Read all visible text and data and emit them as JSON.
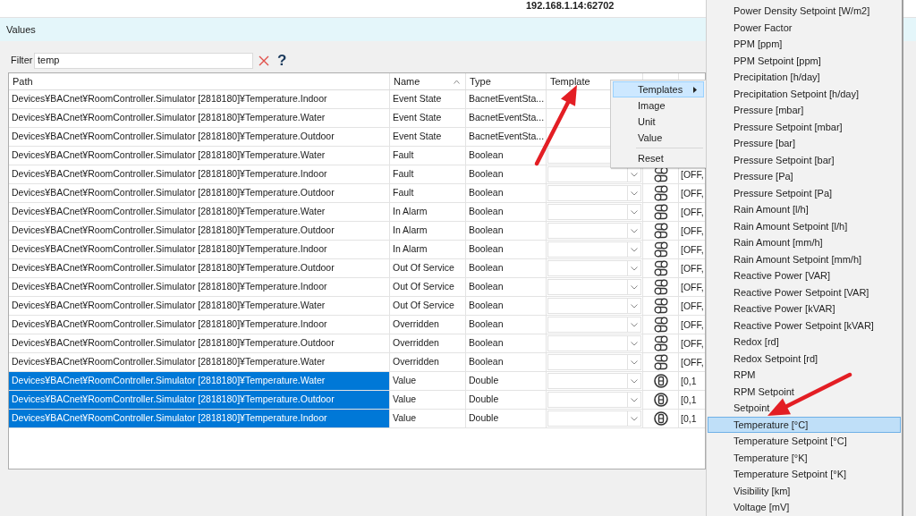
{
  "window": {
    "title": "192.168.1.14:62702"
  },
  "panel": {
    "title": "Values"
  },
  "filter": {
    "label": "Filter",
    "value": "temp",
    "help": "?"
  },
  "table": {
    "columns": [
      {
        "label": "Path",
        "sorted": false
      },
      {
        "label": "Name",
        "sorted": true
      },
      {
        "label": "Type",
        "sorted": false
      },
      {
        "label": "Template",
        "sorted": false
      }
    ],
    "rows": [
      {
        "path": "Devices¥BACnet¥RoomController.Simulator [2818180]¥Temperature.Indoor",
        "name": "Event State",
        "type": "BacnetEventSta...",
        "template_dropdown": false,
        "selected": false
      },
      {
        "path": "Devices¥BACnet¥RoomController.Simulator [2818180]¥Temperature.Water",
        "name": "Event State",
        "type": "BacnetEventSta...",
        "template_dropdown": false,
        "selected": false
      },
      {
        "path": "Devices¥BACnet¥RoomController.Simulator [2818180]¥Temperature.Outdoor",
        "name": "Event State",
        "type": "BacnetEventSta...",
        "template_dropdown": false,
        "selected": false
      },
      {
        "path": "Devices¥BACnet¥RoomController.Simulator [2818180]¥Temperature.Water",
        "name": "Fault",
        "type": "Boolean",
        "template_dropdown": true,
        "selected": false
      },
      {
        "path": "Devices¥BACnet¥RoomController.Simulator [2818180]¥Temperature.Indoor",
        "name": "Fault",
        "type": "Boolean",
        "template_dropdown": true,
        "column_5": {
          "kind": "switches"
        },
        "column_6": "[OFF,",
        "selected": false
      },
      {
        "path": "Devices¥BACnet¥RoomController.Simulator [2818180]¥Temperature.Outdoor",
        "name": "Fault",
        "type": "Boolean",
        "template_dropdown": true,
        "column_5": {
          "kind": "switches"
        },
        "column_6": "[OFF,",
        "selected": false
      },
      {
        "path": "Devices¥BACnet¥RoomController.Simulator [2818180]¥Temperature.Water",
        "name": "In Alarm",
        "type": "Boolean",
        "template_dropdown": true,
        "column_5": {
          "kind": "switches"
        },
        "column_6": "[OFF,",
        "selected": false
      },
      {
        "path": "Devices¥BACnet¥RoomController.Simulator [2818180]¥Temperature.Outdoor",
        "name": "In Alarm",
        "type": "Boolean",
        "template_dropdown": true,
        "column_5": {
          "kind": "switches"
        },
        "column_6": "[OFF,",
        "selected": false
      },
      {
        "path": "Devices¥BACnet¥RoomController.Simulator [2818180]¥Temperature.Indoor",
        "name": "In Alarm",
        "type": "Boolean",
        "template_dropdown": true,
        "column_5": {
          "kind": "switches"
        },
        "column_6": "[OFF,",
        "selected": false
      },
      {
        "path": "Devices¥BACnet¥RoomController.Simulator [2818180]¥Temperature.Outdoor",
        "name": "Out Of Service",
        "type": "Boolean",
        "template_dropdown": true,
        "column_5": {
          "kind": "switches"
        },
        "column_6": "[OFF,",
        "selected": false
      },
      {
        "path": "Devices¥BACnet¥RoomController.Simulator [2818180]¥Temperature.Indoor",
        "name": "Out Of Service",
        "type": "Boolean",
        "template_dropdown": true,
        "column_5": {
          "kind": "switches"
        },
        "column_6": "[OFF,",
        "selected": false
      },
      {
        "path": "Devices¥BACnet¥RoomController.Simulator [2818180]¥Temperature.Water",
        "name": "Out Of Service",
        "type": "Boolean",
        "template_dropdown": true,
        "column_5": {
          "kind": "switches"
        },
        "column_6": "[OFF,",
        "selected": false
      },
      {
        "path": "Devices¥BACnet¥RoomController.Simulator [2818180]¥Temperature.Indoor",
        "name": "Overridden",
        "type": "Boolean",
        "template_dropdown": true,
        "column_5": {
          "kind": "switches"
        },
        "column_6": "[OFF,",
        "selected": false
      },
      {
        "path": "Devices¥BACnet¥RoomController.Simulator [2818180]¥Temperature.Outdoor",
        "name": "Overridden",
        "type": "Boolean",
        "template_dropdown": true,
        "column_5": {
          "kind": "switches"
        },
        "column_6": "[OFF,",
        "selected": false
      },
      {
        "path": "Devices¥BACnet¥RoomController.Simulator [2818180]¥Temperature.Water",
        "name": "Overridden",
        "type": "Boolean",
        "template_dropdown": true,
        "column_5": {
          "kind": "switches"
        },
        "column_6": "[OFF,",
        "selected": false
      },
      {
        "path": "Devices¥BACnet¥RoomController.Simulator [2818180]¥Temperature.Water",
        "name": "Value",
        "type": "Double",
        "template_dropdown": true,
        "column_5": {
          "kind": "digit"
        },
        "column_6": "[0,1",
        "selected": true
      },
      {
        "path": "Devices¥BACnet¥RoomController.Simulator [2818180]¥Temperature.Outdoor",
        "name": "Value",
        "type": "Double",
        "template_dropdown": true,
        "column_5": {
          "kind": "digit"
        },
        "column_6": "[0,1",
        "selected": true
      },
      {
        "path": "Devices¥BACnet¥RoomController.Simulator [2818180]¥Temperature.Indoor",
        "name": "Value",
        "type": "Double",
        "template_dropdown": true,
        "column_5": {
          "kind": "digit"
        },
        "column_6": "[0,1",
        "selected": true
      }
    ]
  },
  "context_menu": {
    "items": [
      {
        "kind": "item",
        "label": "Templates",
        "selected": true,
        "submenu": true
      },
      {
        "kind": "item",
        "label": "Image",
        "selected": false,
        "submenu": false
      },
      {
        "kind": "item",
        "label": "Unit",
        "selected": false,
        "submenu": false
      },
      {
        "kind": "item",
        "label": "Value",
        "selected": false,
        "submenu": false
      },
      {
        "kind": "separator"
      },
      {
        "kind": "item",
        "label": "Reset",
        "selected": false,
        "submenu": false
      }
    ]
  },
  "submenu": {
    "items": [
      {
        "label": "Power Density Setpoint [W/m2]",
        "selected": false
      },
      {
        "label": "Power Factor",
        "selected": false
      },
      {
        "label": "PPM [ppm]",
        "selected": false
      },
      {
        "label": "PPM Setpoint [ppm]",
        "selected": false
      },
      {
        "label": "Precipitation [h/day]",
        "selected": false
      },
      {
        "label": "Precipitation Setpoint [h/day]",
        "selected": false
      },
      {
        "label": "Pressure [mbar]",
        "selected": false
      },
      {
        "label": "Pressure Setpoint [mbar]",
        "selected": false
      },
      {
        "label": "Pressure [bar]",
        "selected": false
      },
      {
        "label": "Pressure Setpoint [bar]",
        "selected": false
      },
      {
        "label": "Pressure [Pa]",
        "selected": false
      },
      {
        "label": "Pressure Setpoint [Pa]",
        "selected": false
      },
      {
        "label": "Rain Amount [l/h]",
        "selected": false
      },
      {
        "label": "Rain Amount Setpoint [l/h]",
        "selected": false
      },
      {
        "label": "Rain Amount [mm/h]",
        "selected": false
      },
      {
        "label": "Rain Amount Setpoint [mm/h]",
        "selected": false
      },
      {
        "label": "Reactive Power [VAR]",
        "selected": false
      },
      {
        "label": "Reactive Power Setpoint [VAR]",
        "selected": false
      },
      {
        "label": "Reactive Power [kVAR]",
        "selected": false
      },
      {
        "label": "Reactive Power Setpoint [kVAR]",
        "selected": false
      },
      {
        "label": "Redox [rd]",
        "selected": false
      },
      {
        "label": "Redox Setpoint [rd]",
        "selected": false
      },
      {
        "label": "RPM",
        "selected": false
      },
      {
        "label": "RPM Setpoint",
        "selected": false
      },
      {
        "label": "Setpoint",
        "selected": false
      },
      {
        "label": "Temperature [°C]",
        "selected": true
      },
      {
        "label": "Temperature Setpoint [°C]",
        "selected": false
      },
      {
        "label": "Temperature [°K]",
        "selected": false
      },
      {
        "label": "Temperature Setpoint [°K]",
        "selected": false
      },
      {
        "label": "Visibility [km]",
        "selected": false
      },
      {
        "label": "Voltage [mV]",
        "selected": false
      }
    ]
  }
}
